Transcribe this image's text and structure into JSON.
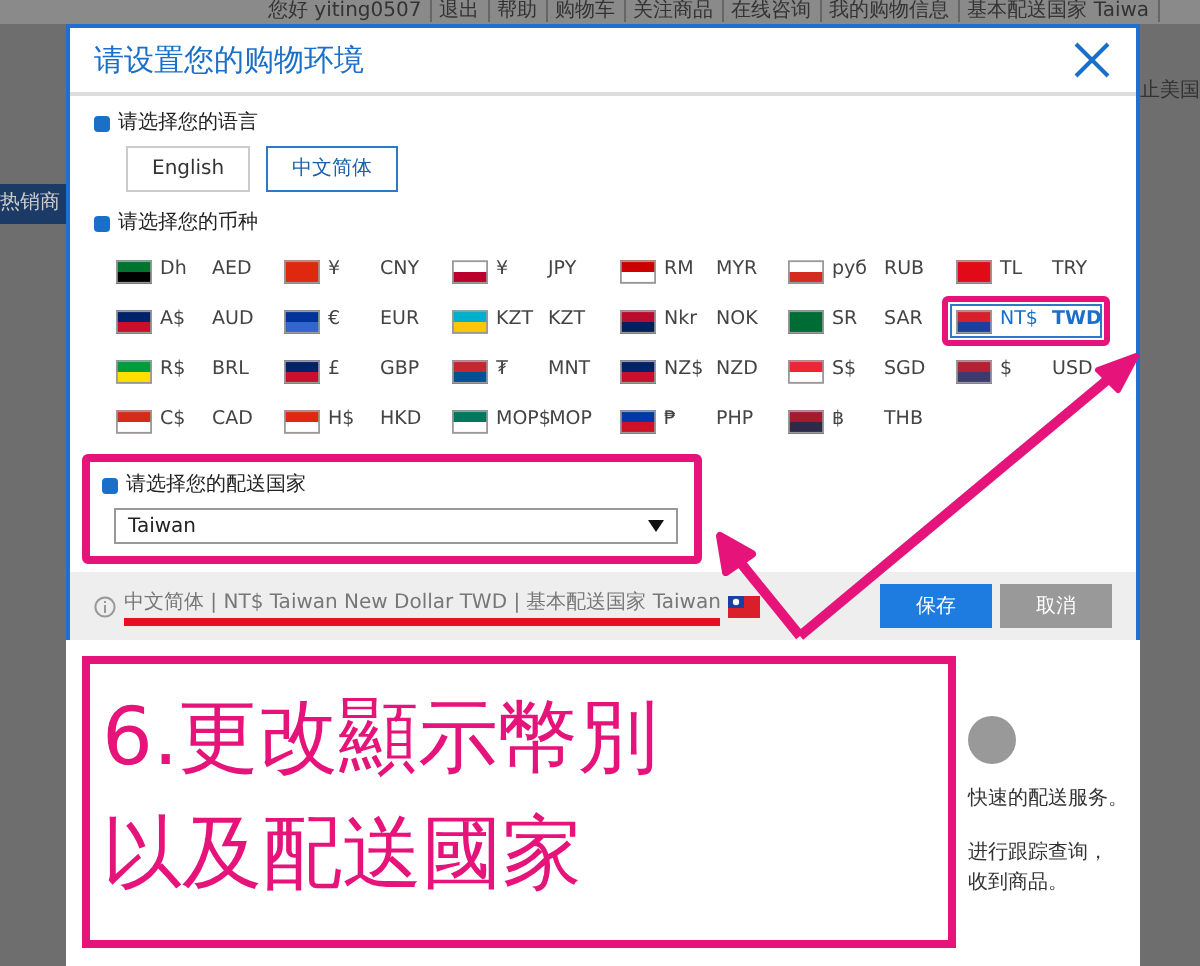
{
  "top_bar": {
    "items": [
      "您好 yiting0507",
      "退出",
      "帮助",
      "购物车",
      "关注商品",
      "在线咨询",
      "我的购物信息",
      "基本配送国家 Taiwa"
    ]
  },
  "left_banner": "热销商",
  "right_banner": "止美国",
  "dialog": {
    "title": "请设置您的购物环境",
    "language": {
      "label": "请选择您的语言",
      "options": [
        {
          "label": "English",
          "selected": false
        },
        {
          "label": "中文简体",
          "selected": true
        }
      ]
    },
    "currency": {
      "label": "请选择您的币种",
      "options": [
        {
          "symbol": "Dh",
          "code": "AED",
          "selected": false,
          "highlighted": false
        },
        {
          "symbol": "¥",
          "code": "CNY",
          "selected": false,
          "highlighted": false
        },
        {
          "symbol": "¥",
          "code": "JPY",
          "selected": false,
          "highlighted": false
        },
        {
          "symbol": "RM",
          "code": "MYR",
          "selected": false,
          "highlighted": false
        },
        {
          "symbol": "руб",
          "code": "RUB",
          "selected": false,
          "highlighted": false
        },
        {
          "symbol": "TL",
          "code": "TRY",
          "selected": false,
          "highlighted": false
        },
        {
          "symbol": "A$",
          "code": "AUD",
          "selected": false,
          "highlighted": false
        },
        {
          "symbol": "€",
          "code": "EUR",
          "selected": false,
          "highlighted": false
        },
        {
          "symbol": "KZT",
          "code": "KZT",
          "selected": false,
          "highlighted": false
        },
        {
          "symbol": "Nkr",
          "code": "NOK",
          "selected": false,
          "highlighted": false
        },
        {
          "symbol": "SR",
          "code": "SAR",
          "selected": false,
          "highlighted": false
        },
        {
          "symbol": "NT$",
          "code": "TWD",
          "selected": true,
          "highlighted": true
        },
        {
          "symbol": "R$",
          "code": "BRL",
          "selected": false,
          "highlighted": false
        },
        {
          "symbol": "£",
          "code": "GBP",
          "selected": false,
          "highlighted": false
        },
        {
          "symbol": "₮",
          "code": "MNT",
          "selected": false,
          "highlighted": false
        },
        {
          "symbol": "NZ$",
          "code": "NZD",
          "selected": false,
          "highlighted": false
        },
        {
          "symbol": "S$",
          "code": "SGD",
          "selected": false,
          "highlighted": false
        },
        {
          "symbol": "$",
          "code": "USD",
          "selected": false,
          "highlighted": false
        },
        {
          "symbol": "C$",
          "code": "CAD",
          "selected": false,
          "highlighted": false
        },
        {
          "symbol": "H$",
          "code": "HKD",
          "selected": false,
          "highlighted": false
        },
        {
          "symbol": "MOP$",
          "code": "MOP",
          "selected": false,
          "highlighted": false
        },
        {
          "symbol": "₱",
          "code": "PHP",
          "selected": false,
          "highlighted": false
        },
        {
          "symbol": "฿",
          "code": "THB",
          "selected": false,
          "highlighted": false
        }
      ]
    },
    "delivery": {
      "label": "请选择您的配送国家",
      "value": "Taiwan",
      "highlighted": true
    },
    "summary": {
      "text": "中文简体 | NT$ Taiwan New Dollar TWD | 基本配送国家 Taiwan",
      "underlined": true
    },
    "buttons": [
      {
        "label": "保存",
        "kind": "primary"
      },
      {
        "label": "取消",
        "kind": "secondary"
      }
    ]
  },
  "page_behind": {
    "texts": [
      "快速的配送服务。",
      "进行跟踪查询，",
      "收到商品。"
    ]
  },
  "annotation": {
    "lines": [
      "6.更改顯示幣別",
      "以及配送國家"
    ]
  }
}
